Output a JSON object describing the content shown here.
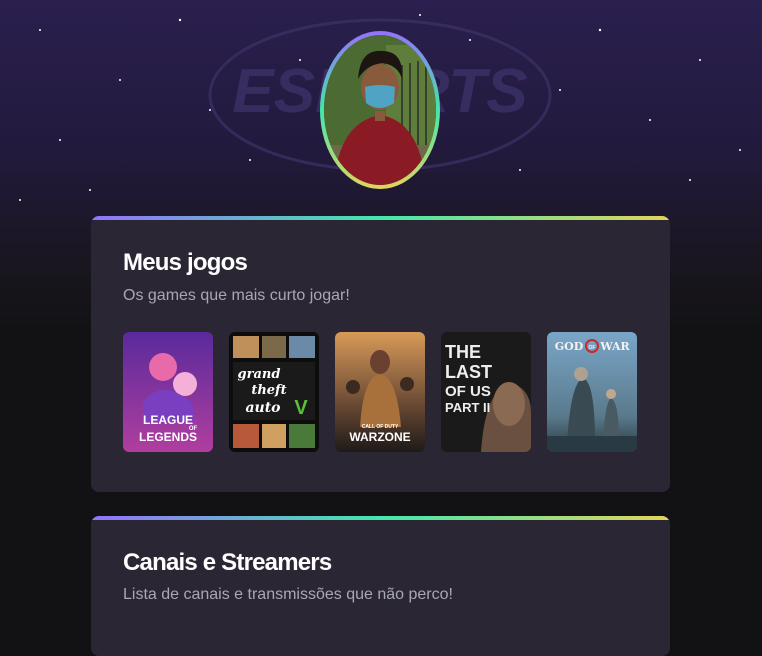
{
  "hero": {
    "watermark_text": "ESPORTS"
  },
  "profile": {
    "avatar_icon": "user-avatar"
  },
  "games_section": {
    "title": "Meus jogos",
    "subtitle": "Os games que mais curto jogar!",
    "games": [
      {
        "name": "League of Legends",
        "cover_lines": [
          "LEAGUE",
          "LEGENDS"
        ],
        "cover_small": "OF"
      },
      {
        "name": "Grand Theft Auto V",
        "cover_lines": [
          "grand",
          "theft",
          "auto"
        ],
        "cover_small": "V"
      },
      {
        "name": "Call of Duty Warzone",
        "cover_lines": [
          "WARZONE"
        ],
        "cover_small": "CALL OF DUTY"
      },
      {
        "name": "The Last of Us Part II",
        "cover_lines": [
          "THE",
          "LAST",
          "OF US",
          "PART II"
        ],
        "cover_small": ""
      },
      {
        "name": "God of War",
        "cover_lines": [
          "GOD",
          "WAR"
        ],
        "cover_small": "OF"
      }
    ]
  },
  "channels_section": {
    "title": "Canais e Streamers",
    "subtitle": "Lista de canais e transmissões que não perco!"
  },
  "colors": {
    "gradient_start": "#9572fc",
    "gradient_mid": "#43e7ad",
    "gradient_end": "#e2d45c",
    "card_bg": "#2a2634",
    "page_bg": "#121214"
  }
}
